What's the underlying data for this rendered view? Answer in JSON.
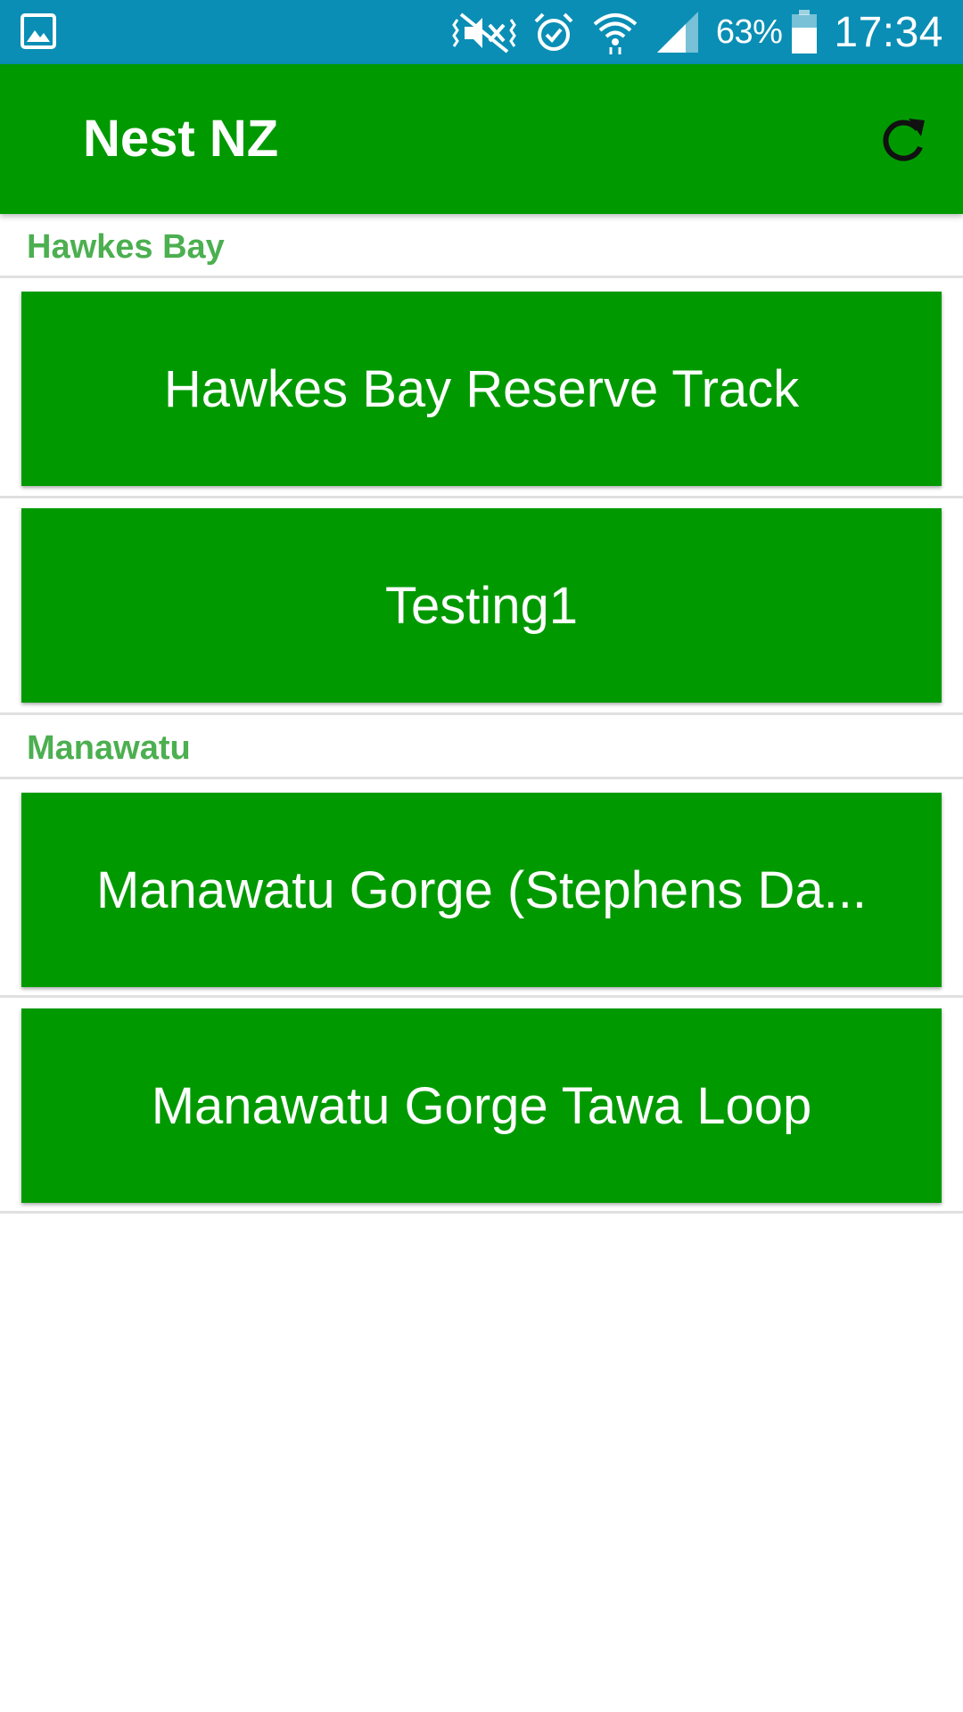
{
  "status_bar": {
    "battery_percent": "63%",
    "time": "17:34",
    "icons": [
      "gallery-icon",
      "vibrate-mute-icon",
      "alarm-icon",
      "wifi-icon",
      "signal-icon",
      "battery-icon"
    ]
  },
  "app_bar": {
    "title": "Nest NZ",
    "action_icon": "refresh-icon"
  },
  "sections": [
    {
      "header": "Hawkes Bay",
      "tracks": [
        "Hawkes Bay Reserve Track",
        "Testing1"
      ]
    },
    {
      "header": "Manawatu",
      "tracks": [
        "Manawatu Gorge (Stephens Da...",
        "Manawatu Gorge Tawa Loop"
      ]
    }
  ],
  "colors": {
    "status_bar": "#0a8eb5",
    "primary": "#009a00",
    "section_header_text": "#4caf50",
    "divider": "#e0e0e0"
  }
}
